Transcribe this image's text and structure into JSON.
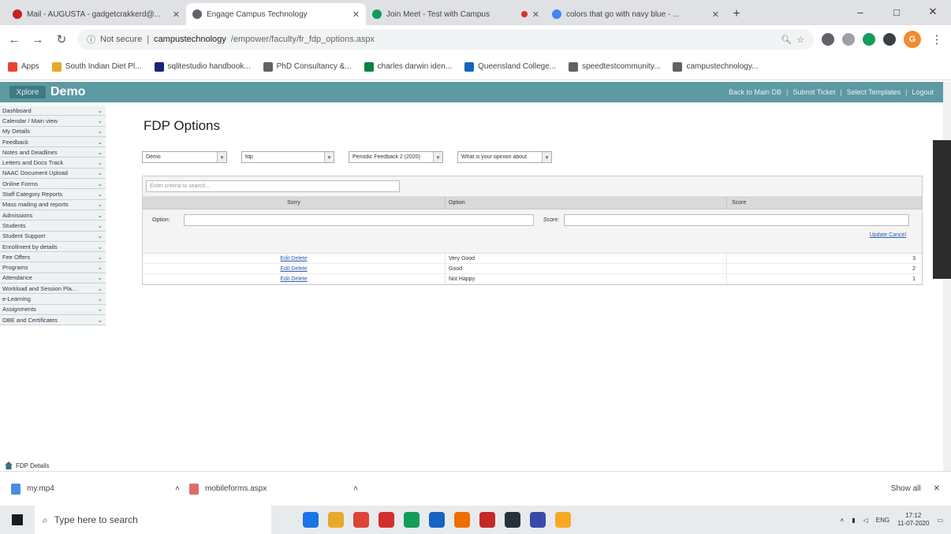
{
  "browser": {
    "tabs": [
      {
        "title": "Mail - AUGUSTA - gadgetcrakkerd@...",
        "active": false,
        "recording": false
      },
      {
        "title": "Engage Campus Technology",
        "active": true,
        "recording": false
      },
      {
        "title": "Join Meet - Test with Campus",
        "active": false,
        "recording": true
      },
      {
        "title": "colors that go with navy blue - ...",
        "active": false,
        "recording": false
      }
    ],
    "new_tab": "+",
    "window_controls": [
      "–",
      "□",
      "✕"
    ],
    "url_warning": "Not secure",
    "url_host": "campustechnology",
    "url_rest": "/empower/faculty/fr_fdp_options.aspx",
    "bookmarks": [
      "Apps",
      "South Indian Diet Pl...",
      "sqlitestudio handbook...",
      "PhD Consultancy &...",
      "charles darwin iden...",
      "Queensland College...",
      "speedtestcommunity...",
      "campustechnology..."
    ]
  },
  "app": {
    "brand_logo": "Xplore",
    "brand_name": "Demo",
    "top_links": [
      "Back to Main DB",
      "Submit Ticket",
      "Select Templates",
      "Logout"
    ]
  },
  "sidebar": {
    "items": [
      "Dashboard",
      "Calendar / Main view",
      "My Details",
      "Feedback",
      "Notes and Deadlines",
      "Letters and Docs Track",
      "NAAC Document Upload",
      "Online Forms",
      "Staff Category Reports",
      "Mass mailing and reports",
      "Admissions",
      "Students",
      "Student Support",
      "Enrollment by details",
      "Fee Offers",
      "Programs",
      "Attendance",
      "Workload and Session Pla...",
      "e-Learning",
      "Assignments",
      "OBE and Certificates"
    ],
    "footer": "FDP Details"
  },
  "main": {
    "page_title": "FDP Options",
    "filters": [
      {
        "value": "Demo",
        "width": "108"
      },
      {
        "value": "fdp",
        "width": "118"
      },
      {
        "value": "Periodic Feedback 2 (2020)",
        "width": "120"
      },
      {
        "value": "What is your opinion about",
        "width": "120"
      }
    ],
    "search_placeholder": "Enter criteria to search...",
    "columns": [
      "Sorry",
      "Option",
      "Score"
    ],
    "edit": {
      "option_label": "Option:",
      "score_label": "Score:",
      "update_cancel": "Update Cancel"
    },
    "rows": [
      {
        "action": "Edit Delete",
        "option": "Very Good",
        "score": "3"
      },
      {
        "action": "Edit Delete",
        "option": "Good",
        "score": "2"
      },
      {
        "action": "Edit Delete",
        "option": "Not Happy",
        "score": "1"
      }
    ]
  },
  "downloads": {
    "items": [
      {
        "name": "my.mp4",
        "type": "video"
      },
      {
        "name": "mobileforms.aspx",
        "type": "pdf"
      }
    ],
    "show_all": "Show all",
    "close": "✕"
  },
  "taskbar": {
    "search_placeholder": "Type here to search",
    "lang": "ENG",
    "time": "17:12",
    "date": "11-07-2020",
    "icon_colors": [
      "#1a73e8",
      "#e8a82a",
      "#db4437",
      "#d32f2f",
      "#0f9d58",
      "#1565c0",
      "#ef6c00",
      "#c62828",
      "#263238",
      "#3949ab",
      "#f9a825"
    ]
  }
}
